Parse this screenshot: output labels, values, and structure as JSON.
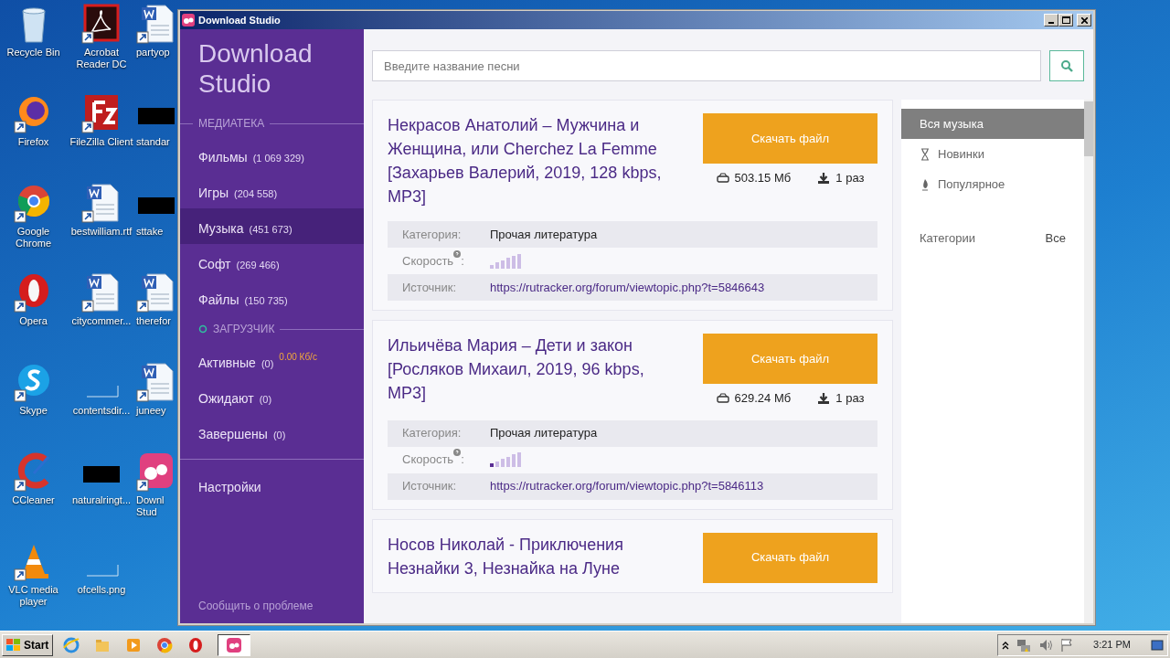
{
  "desktop": {
    "icons": [
      {
        "label": "Recycle Bin",
        "kind": "recycle"
      },
      {
        "label": "Firefox",
        "kind": "firefox"
      },
      {
        "label": "Google Chrome",
        "kind": "chrome"
      },
      {
        "label": "Opera",
        "kind": "opera"
      },
      {
        "label": "Skype",
        "kind": "skype"
      },
      {
        "label": "CCleaner",
        "kind": "ccleaner"
      },
      {
        "label": "VLC media player",
        "kind": "vlc"
      },
      {
        "label": "Acrobat Reader DC",
        "kind": "acrobat"
      },
      {
        "label": "FileZilla Client",
        "kind": "filezilla"
      },
      {
        "label": "bestwilliam.rtf",
        "kind": "word"
      },
      {
        "label": "citycommer...",
        "kind": "word"
      },
      {
        "label": "contentsdir...",
        "kind": "blank"
      },
      {
        "label": "naturalringt...",
        "kind": "redacted"
      },
      {
        "label": "ofcells.png",
        "kind": "blank"
      },
      {
        "label": "partyop",
        "kind": "word"
      },
      {
        "label": "standar",
        "kind": "redacted"
      },
      {
        "label": "sttake",
        "kind": "redacted"
      },
      {
        "label": "therefor",
        "kind": "word"
      },
      {
        "label": "juneey",
        "kind": "word"
      },
      {
        "label": "Downl Stud",
        "kind": "ds"
      }
    ]
  },
  "window": {
    "title": "Download Studio"
  },
  "sidebar": {
    "logo": "Download Studio",
    "sections": [
      {
        "heading": "МЕДИАТЕКА",
        "kind": "library",
        "items": [
          {
            "label": "Фильмы",
            "count": "(1 069 329)",
            "selected": false
          },
          {
            "label": "Игры",
            "count": "(204 558)",
            "selected": false
          },
          {
            "label": "Музыка",
            "count": "(451 673)",
            "selected": true
          },
          {
            "label": "Софт",
            "count": "(269 466)",
            "selected": false
          },
          {
            "label": "Файлы",
            "count": "(150 735)",
            "selected": false
          }
        ]
      },
      {
        "heading": "ЗАГРУЗЧИК",
        "kind": "loader",
        "items": [
          {
            "label": "Активные",
            "count": "(0)",
            "speed": "0.00 Кб/с",
            "selected": false
          },
          {
            "label": "Ожидают",
            "count": "(0)",
            "selected": false
          },
          {
            "label": "Завершены",
            "count": "(0)",
            "selected": false
          }
        ]
      }
    ],
    "settings": "Настройки",
    "report": "Сообщить о проблеме"
  },
  "search": {
    "placeholder": "Введите название песни"
  },
  "results": [
    {
      "title": "Некрасов Анатолий – Мужчина и Женщина, или Cherchez La Femme [Захарьев Валерий, 2019, 128 kbps, MP3]",
      "button": "Скачать файл",
      "size": "503.15 Мб",
      "downloads": "1 раз",
      "fields": [
        {
          "kind": "text",
          "label": "Категория:",
          "value": "Прочая литература"
        },
        {
          "kind": "speed",
          "label": "Скорость",
          "suffix": ":",
          "level": 0
        },
        {
          "kind": "link",
          "label": "Источник:",
          "value": "https://rutracker.org/forum/viewtopic.php?t=5846643"
        }
      ]
    },
    {
      "title": "Ильичёва Мария – Дети и закон [Росляков Михаил, 2019, 96 kbps, MP3]",
      "button": "Скачать файл",
      "size": "629.24 Мб",
      "downloads": "1 раз",
      "fields": [
        {
          "kind": "text",
          "label": "Категория:",
          "value": "Прочая литература"
        },
        {
          "kind": "speed",
          "label": "Скорость",
          "suffix": ":",
          "level": 0.17
        },
        {
          "kind": "link",
          "label": "Источник:",
          "value": "https://rutracker.org/forum/viewtopic.php?t=5846113"
        }
      ]
    },
    {
      "title": "Носов Николай - Приключения Незнайки 3, Незнайка на Луне",
      "button": "Скачать файл"
    }
  ],
  "filters": {
    "items": [
      {
        "label": "Вся музыка",
        "kind": "all",
        "selected": true
      },
      {
        "label": "Новинки",
        "kind": "new",
        "selected": false
      },
      {
        "label": "Популярное",
        "kind": "popular",
        "selected": false
      }
    ],
    "category_label": "Категории",
    "category_value": "Все"
  },
  "taskbar": {
    "start": "Start",
    "apps": [
      {
        "kind": "ie",
        "active": false
      },
      {
        "kind": "explorer",
        "active": false
      },
      {
        "kind": "media",
        "active": false
      },
      {
        "kind": "chrome",
        "active": false
      },
      {
        "kind": "opera",
        "active": false
      },
      {
        "kind": "ds",
        "active": true
      }
    ],
    "clock": "3:21 PM"
  }
}
